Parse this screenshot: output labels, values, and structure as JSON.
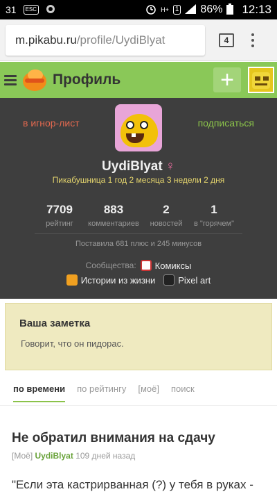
{
  "status_bar": {
    "notification_count": "31",
    "esc_icon": "ESC",
    "network": "H+",
    "signal_box": "1",
    "battery": "86%",
    "time": "12:13"
  },
  "browser": {
    "url_host": "m.pikabu.ru",
    "url_path": "/profile/UydiBlyat",
    "tab_count": "4"
  },
  "header": {
    "title": "Профиль",
    "add_button_label": "+",
    "brand_color": "#8ac858"
  },
  "profile": {
    "ignore_label": "в игнор-лист",
    "subscribe_label": "подписаться",
    "username": "UydiBlyat",
    "gender_symbol": "♀",
    "tenure": "Пикабушница 1 год 2 месяца 3 недели 2 дня",
    "stats": [
      {
        "value": "7709",
        "label": "рейтинг"
      },
      {
        "value": "883",
        "label": "комментариев"
      },
      {
        "value": "2",
        "label": "новостей"
      },
      {
        "value": "1",
        "label": "в \"горячем\""
      }
    ],
    "votes": "Поставила 681 плюс и 245 минусов",
    "communities_label": "Сообщества:",
    "communities": [
      {
        "name": "Комиксы",
        "icon": "comics-icon"
      },
      {
        "name": "Истории из жизни",
        "icon": "life-stories-icon"
      },
      {
        "name": "Pixel art",
        "icon": "pixel-art-icon"
      }
    ]
  },
  "note": {
    "title": "Ваша заметка",
    "text": "Говорит, что он пидорас."
  },
  "sort_tabs": [
    {
      "label": "по времени",
      "active": true
    },
    {
      "label": "по рейтингу",
      "active": false
    },
    {
      "label": "[моё]",
      "active": false
    },
    {
      "label": "поиск",
      "active": false
    }
  ],
  "post": {
    "title": "Не обратил внимания на сдачу",
    "tag": "[Моё]",
    "author": "UydiBlyat",
    "time": "109 дней назад",
    "body": "\"Если эта кастрирванная (?) у тебя в руках -"
  }
}
